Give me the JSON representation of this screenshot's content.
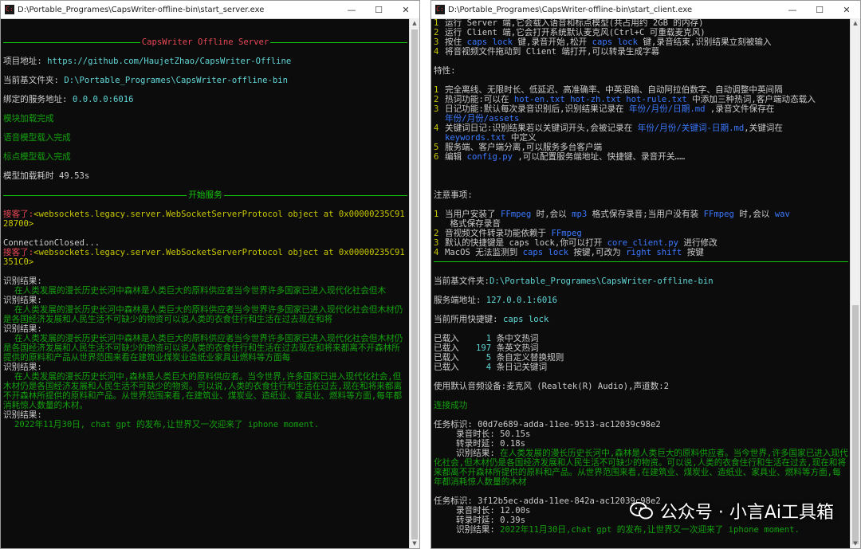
{
  "server": {
    "title": "D:\\Portable_Programes\\CapsWriter-offline-bin\\start_server.exe",
    "banner": "CapsWriter Offline Server",
    "project_label": "项目地址:",
    "project_url": "https://github.com/HaujetZhao/CapsWriter-Offline",
    "cwd_label": "当前基文件夹:",
    "cwd_value": "D:\\Portable_Programes\\CapsWriter-offline-bin",
    "bind_label": "绑定的服务地址:",
    "bind_value": "0.0.0.0:6016",
    "module_loaded": "模块加载完成",
    "speech_loaded": "语音模型载入完成",
    "punc_loaded": "标点模型载入完成",
    "load_time_label": "模型加载耗时",
    "load_time_value": "49.53s",
    "start_service": "开始服务",
    "conn1_label": "接客了:",
    "conn1_value": "<websockets.legacy.server.WebSocketServerProtocol object at 0x00000235C9128700>",
    "closed": "ConnectionClosed...",
    "conn2_label": "接客了:",
    "conn2_value": "<websockets.legacy.server.WebSocketServerProtocol object at 0x00000235C91351C0>",
    "results": [
      {
        "label": "识别结果:",
        "text": "在人类发展的漫长历史长河中森林是人类巨大的原料供应者当今世界许多国家已进入现代化社会但木"
      },
      {
        "label": "识别结果:",
        "text": "在人类发展的漫长历史长河中森林是人类巨大的原料供应者当今世界许多国家已进入现代化社会但木材仍是各国经济发展和人民生活不可缺少的物资可以说人类的衣食住行和生活在过去现在和将"
      },
      {
        "label": "识别结果:",
        "text": "在人类发展的漫长历史长河中森林是人类巨大的原料供应者当今世界许多国家已进入现代化社会但木材仍是各国经济发展和人民生活不可缺少的物资可以说人类的衣食住行和生活在过去现在和将来都离不开森林所提供的原料和产品从世界范围来看在建筑业煤炭业造纸业家具业燃料等方面每"
      },
      {
        "label": "识别结果:",
        "text": "在人类发展的漫长历史长河中,森林是人类巨大的原料供应者。当今世界,许多国家已进入现代化社会,但木材仍是各国经济发展和人民生活不可缺少的物资。可以说,人类的衣食住行和生活在过去,现在和将来都离不开森林所提供的原料和产品。从世界范围来看,在建筑业、煤炭业、造纸业、家具业、燃料等方面,每年都消耗惊人数量的木材。"
      },
      {
        "label": "识别结果:",
        "text": "2022年11月30日, chat gpt 的发布,让世界又一次迎来了 iphone moment."
      }
    ]
  },
  "client": {
    "title": "D:\\Portable_Programes\\CapsWriter-offline-bin\\start_client.exe",
    "steps": [
      {
        "n": "1",
        "text": "运行 Server 端,它会载入语音和标点模型(共占用约 2GB 的内存)"
      },
      {
        "n": "2",
        "text": "运行 Client 端,它会打开系统默认麦克风(Ctrl+C 可重载麦克风)"
      },
      {
        "n": "3",
        "a": "按住 ",
        "k1": "caps lock",
        "b": " 键,录音开始,松开 ",
        "k2": "caps lock",
        "c": " 键,录音结束,识别结果立刻被输入"
      },
      {
        "n": "4",
        "text": "将音视频文件拖动到 Client 端打开,可以转录生成字幕"
      }
    ],
    "features_heading": "特性:",
    "features": [
      {
        "n": "1",
        "text": "完全离线、无限时长、低延迟、高准确率、中英混输、自动阿拉伯数字、自动调整中英间隔"
      },
      {
        "n": "2",
        "a": "热词功能:可以在 ",
        "f1": "hot-en.txt hot-zh.txt hot-rule.txt",
        "b": " 中添加三种热词,客户端动态载入"
      },
      {
        "n": "3",
        "a": "日记功能:默认每次录音识别后,识别结果记录在 ",
        "f1": "年份/月份/日期.md",
        "b": " ,录音文件保存在 ",
        "f2": "年份/月份/assets"
      },
      {
        "n": "4",
        "a": "关键词日记:识别结果若以关键词开头,会被记录在 ",
        "f1": "年份/月份/关键词-日期.md",
        "b": ",关键词在 ",
        "f2": "keywords.txt",
        "c": " 中定义"
      },
      {
        "n": "5",
        "text": "服务端、客户端分离,可以服务多台客户端"
      },
      {
        "n": "6",
        "a": "编辑 ",
        "f1": "config.py",
        "b": " ,可以配置服务端地址、快捷键、录音开关……"
      }
    ],
    "notes_heading": "注意事项:",
    "notes": [
      {
        "n": "1",
        "a": "当用户安装了 ",
        "f1": "FFmpeg",
        "b": " 时,会以 ",
        "f2": "mp3",
        "c": " 格式保存录音;当用户没有装 ",
        "f3": "FFmpeg",
        "d": " 时,会以 ",
        "f4": "wav",
        "e": " 格式保存录音"
      },
      {
        "n": "2",
        "a": "音视频文件转录功能依赖于 ",
        "f1": "FFmpeg"
      },
      {
        "n": "3",
        "a": "默认的快捷键是 caps lock,你可以打开 ",
        "f1": "core_client.py",
        "b": " 进行修改"
      },
      {
        "n": "4",
        "a": "MacOS 无法监测到 ",
        "f1": "caps lock",
        "b": " 按键,可改为 ",
        "f2": "right shift",
        "c": " 按键"
      }
    ],
    "cwd_label": "当前基文件夹:",
    "cwd_value": "D:\\Portable_Programes\\CapsWriter-offline-bin",
    "server_label": "服务端地址:",
    "server_value": "127.0.0.1:6016",
    "hotkey_label": "当前所用快捷键:",
    "hotkey_value": "caps lock",
    "loaded": [
      {
        "label": "已载入",
        "count": "1",
        "desc": "条中文热词"
      },
      {
        "label": "已载入",
        "count": "197",
        "desc": "条英文热词"
      },
      {
        "label": "已载入",
        "count": "5",
        "desc": "条自定义替换规则"
      },
      {
        "label": "已载入",
        "count": "4",
        "desc": "条日记关键词"
      }
    ],
    "device_line": "使用默认音频设备:麦克风 (Realtek(R) Audio),声道数:2",
    "connected": "连接成功",
    "tasks": [
      {
        "id_label": "任务标识:",
        "id": "00d7e689-adda-11ee-9513-ac12039c98e2",
        "rec_label": "录音时长:",
        "rec": "50.15s",
        "trans_label": "转录时延:",
        "trans": "0.18s",
        "res_label": "识别结果:",
        "res": "在人类发展的漫长历史长河中,森林是人类巨大的原料供应者。当今世界,许多国家已进入现代化社会,但木材仍是各国经济发展和人民生活不可缺少的物资。可以说,人类的衣食住行和生活在过去,现在和将来都离不开森林所提供的原料和产品。从世界范围来看,在建筑业、煤炭业、造纸业、家具业、燃料等方面,每年都消耗惊人数量的木材"
      },
      {
        "id_label": "任务标识:",
        "id": "3f12b5ec-adda-11ee-842a-ac12039c98e2",
        "rec_label": "录音时长:",
        "rec": "12.00s",
        "trans_label": "转录时延:",
        "trans": "0.39s",
        "res_label": "识别结果:",
        "res": "2022年11月30日,chat gpt 的发布,让世界又一次迎来了 iphone moment."
      }
    ]
  },
  "watermark": "公众号 · 小言Ai工具箱",
  "controls": {
    "minimize": "—",
    "maximize": "☐",
    "close": "✕"
  },
  "colors": {
    "bright_green": "#16c60c",
    "dark_green": "#13a10e",
    "red": "#e74856",
    "blue": "#3b78ff",
    "yellow": "#c8c800"
  }
}
